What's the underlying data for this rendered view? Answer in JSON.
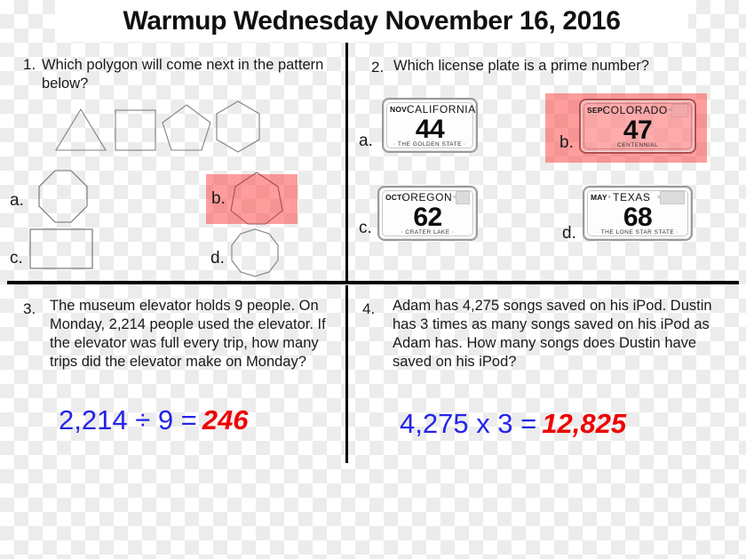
{
  "header": {
    "title": "Warmup Wednesday November 16, 2016"
  },
  "questions": {
    "q1": {
      "number": "1.",
      "text": "Which polygon will come next in the pattern below?",
      "pattern_shapes": [
        "triangle",
        "square",
        "pentagon",
        "hexagon"
      ],
      "options": [
        {
          "label": "a.",
          "shape": "octagon",
          "highlighted": false
        },
        {
          "label": "b.",
          "shape": "heptagon",
          "highlighted": true
        },
        {
          "label": "c.",
          "shape": "rectangle",
          "highlighted": false
        },
        {
          "label": "d.",
          "shape": "nonagon",
          "highlighted": false
        }
      ]
    },
    "q2": {
      "number": "2.",
      "text": "Which license plate is a prime number?",
      "options": [
        {
          "label": "a.",
          "month": "NOV",
          "state": "CALIFORNIA",
          "number": "44",
          "slogan": "THE GOLDEN STATE",
          "highlighted": false
        },
        {
          "label": "b.",
          "month": "SEP",
          "state": "COLORADO",
          "number": "47",
          "slogan": "CENTENNIAL",
          "highlighted": true
        },
        {
          "label": "c.",
          "month": "OCT",
          "state": "OREGON",
          "number": "62",
          "slogan": "CRATER LAKE",
          "highlighted": false
        },
        {
          "label": "d.",
          "month": "MAY",
          "state": "TEXAS",
          "number": "68",
          "slogan": "THE LONE STAR STATE",
          "highlighted": false
        }
      ]
    },
    "q3": {
      "number": "3.",
      "text": "The museum elevator holds 9 people. On Monday, 2,214 people used the elevator. If the elevator was full every trip, how many trips did the elevator make on Monday?",
      "equation": "2,214 ÷ 9 =",
      "answer": "246"
    },
    "q4": {
      "number": "4.",
      "text": "Adam has 4,275 songs saved on his iPod. Dustin has 3 times as many songs saved on his iPod as Adam has. How many songs does Dustin have saved on his iPod?",
      "equation": "4,275 x 3 =",
      "answer": "12,825"
    }
  },
  "colors": {
    "highlight": "#ff4d4d",
    "equation": "#2424e8",
    "answer": "#ee0000",
    "divider": "#000000",
    "shape_outline": "#777777"
  }
}
